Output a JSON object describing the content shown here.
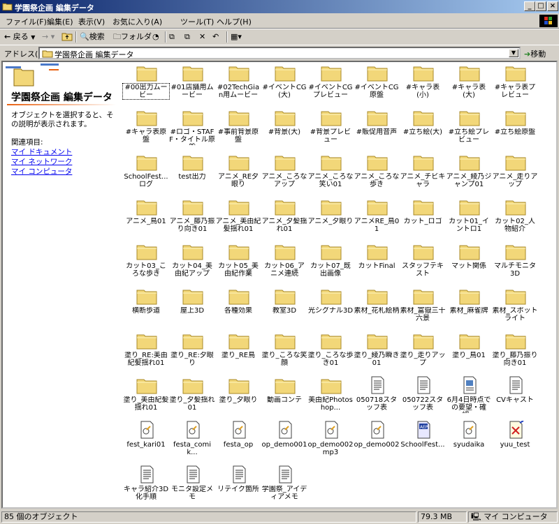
{
  "window": {
    "title": "学園祭企画 編集データ",
    "controls": {
      "minimize": "_",
      "maximize": "□",
      "close": "×"
    }
  },
  "menu": [
    "ファイル(F)",
    "編集(E)",
    "表示(V)",
    "お気に入り(A)",
    "ツール(T)",
    "ヘルプ(H)"
  ],
  "toolbar": {
    "back": "戻る",
    "search": "検索",
    "folders": "フォルダ"
  },
  "address": {
    "label": "アドレス(D)",
    "value": "学園祭企画 編集データ",
    "go": "移動"
  },
  "left_panel": {
    "title": "学園祭企画 編集データ",
    "description": "オブジェクトを選択すると、その説明が表示されます。",
    "related_label": "関連項目:",
    "links": [
      "マイ ドキュメント",
      "マイ ネットワーク",
      "マイ コンピュータ"
    ]
  },
  "items": [
    {
      "label": "#00出力ムービー",
      "type": "folder"
    },
    {
      "label": "#01店舗用ムービー",
      "type": "folder"
    },
    {
      "label": "#02TechGian用ムービー",
      "type": "folder"
    },
    {
      "label": "#イベントCG(大)",
      "type": "folder"
    },
    {
      "label": "#イベントCGプレビュー",
      "type": "folder"
    },
    {
      "label": "#イベントCG原盤",
      "type": "folder"
    },
    {
      "label": "#キャラ表(小)",
      "type": "folder"
    },
    {
      "label": "#キャラ表(大)",
      "type": "folder"
    },
    {
      "label": "#キャラ表プレビュー",
      "type": "folder"
    },
    {
      "label": "#キャラ表原盤",
      "type": "folder"
    },
    {
      "label": "#ロゴ・STAFF・タイトル原盤",
      "type": "folder"
    },
    {
      "label": "#事前背景原盤",
      "type": "folder"
    },
    {
      "label": "#背景(大)",
      "type": "folder"
    },
    {
      "label": "#背景プレビュー",
      "type": "folder"
    },
    {
      "label": "#販促用音声",
      "type": "folder"
    },
    {
      "label": "#立ち絵(大)",
      "type": "folder"
    },
    {
      "label": "#立ち絵プレビュー",
      "type": "folder"
    },
    {
      "label": "#立ち絵原盤",
      "type": "folder"
    },
    {
      "label": "SchoolFest...ログ",
      "type": "folder"
    },
    {
      "label": "test出力",
      "type": "folder"
    },
    {
      "label": "アニメ_RE夕眼り",
      "type": "folder"
    },
    {
      "label": "アニメ_ころなアップ",
      "type": "folder"
    },
    {
      "label": "アニメ_ころな笑い01",
      "type": "folder"
    },
    {
      "label": "アニメ_ころな歩き",
      "type": "folder"
    },
    {
      "label": "アニメ_チビキャラ",
      "type": "folder"
    },
    {
      "label": "アニメ_綾乃ジャンプ01",
      "type": "folder"
    },
    {
      "label": "アニメ_走りアップ",
      "type": "folder"
    },
    {
      "label": "アニメ_鳥01",
      "type": "folder"
    },
    {
      "label": "アニメ_藤乃振り向き01",
      "type": "folder"
    },
    {
      "label": "アニメ_美由紀髪揺れ01",
      "type": "folder"
    },
    {
      "label": "アニメ_夕髪揺れ01",
      "type": "folder"
    },
    {
      "label": "アニメ_夕眼り",
      "type": "folder"
    },
    {
      "label": "アニメRE_鳥01",
      "type": "folder"
    },
    {
      "label": "カット_ロゴ",
      "type": "folder"
    },
    {
      "label": "カット01_イントロ1",
      "type": "folder"
    },
    {
      "label": "カット02_人物紹介",
      "type": "folder"
    },
    {
      "label": "カット03_ころな歩き",
      "type": "folder"
    },
    {
      "label": "カット04_美由紀アップ",
      "type": "folder"
    },
    {
      "label": "カット05_美由紀作業",
      "type": "folder"
    },
    {
      "label": "カット06_アニメ連続",
      "type": "folder"
    },
    {
      "label": "カット07_既出画像",
      "type": "folder"
    },
    {
      "label": "カットFinal",
      "type": "folder"
    },
    {
      "label": "スタッフテキスト",
      "type": "folder"
    },
    {
      "label": "マット関係",
      "type": "folder"
    },
    {
      "label": "マルチモニタ3D",
      "type": "folder"
    },
    {
      "label": "横断歩道",
      "type": "folder"
    },
    {
      "label": "屋上3D",
      "type": "folder"
    },
    {
      "label": "各種効果",
      "type": "folder"
    },
    {
      "label": "教室3D",
      "type": "folder"
    },
    {
      "label": "光シグナル3D",
      "type": "folder"
    },
    {
      "label": "素材_花札絵柄",
      "type": "folder"
    },
    {
      "label": "素材_富嶽三十六景",
      "type": "folder"
    },
    {
      "label": "素材_麻雀牌",
      "type": "folder"
    },
    {
      "label": "素材_スポットライト",
      "type": "folder"
    },
    {
      "label": "塗り_RE:美由紀髪揺れ01",
      "type": "folder"
    },
    {
      "label": "塗り_RE:夕眼り",
      "type": "folder"
    },
    {
      "label": "塗り_RE鳥",
      "type": "folder"
    },
    {
      "label": "塗り_ころな笑顔",
      "type": "folder"
    },
    {
      "label": "塗り_ころな歩き01",
      "type": "folder"
    },
    {
      "label": "塗り_綾乃瞬き01",
      "type": "folder"
    },
    {
      "label": "塗り_走りアップ",
      "type": "folder"
    },
    {
      "label": "塗り_鳥01",
      "type": "folder"
    },
    {
      "label": "塗り_藤乃振り向き01",
      "type": "folder"
    },
    {
      "label": "塗り_美由紀髪揺れ01",
      "type": "folder"
    },
    {
      "label": "塗り_夕髪揺れ01",
      "type": "folder"
    },
    {
      "label": "塗り_夕眼り",
      "type": "folder"
    },
    {
      "label": "動画コンテ",
      "type": "folder"
    },
    {
      "label": "美由紀Photoshop...",
      "type": "folder"
    },
    {
      "label": "050718スタッフ表",
      "type": "doc"
    },
    {
      "label": "050722スタッフ表",
      "type": "doc"
    },
    {
      "label": "6月4日時点での要望・確認...",
      "type": "docimg"
    },
    {
      "label": "CVキャスト",
      "type": "doc"
    },
    {
      "label": "fest_kari01",
      "type": "media"
    },
    {
      "label": "festa_comik...",
      "type": "media"
    },
    {
      "label": "festa_op",
      "type": "media"
    },
    {
      "label": "op_demo001",
      "type": "media"
    },
    {
      "label": "op_demo002mp3",
      "type": "media"
    },
    {
      "label": "op_demo002",
      "type": "media"
    },
    {
      "label": "SchoolFest...",
      "type": "aep"
    },
    {
      "label": "syudaika",
      "type": "media"
    },
    {
      "label": "yuu_test",
      "type": "redx"
    },
    {
      "label": "キャラ紹介3D化手順",
      "type": "doc"
    },
    {
      "label": "モニタ設定メモ",
      "type": "doc"
    },
    {
      "label": "リテイク箇所",
      "type": "doc"
    },
    {
      "label": "学園祭_アイディアメモ",
      "type": "doc"
    }
  ],
  "status": {
    "objects": "85 個のオブジェクト",
    "size": "79.3 MB",
    "location": "マイ コンピュータ"
  },
  "colors": {
    "folder": "#f2d779",
    "title_start": "#0a246a",
    "title_end": "#a6caf0",
    "link": "#0000ee"
  }
}
